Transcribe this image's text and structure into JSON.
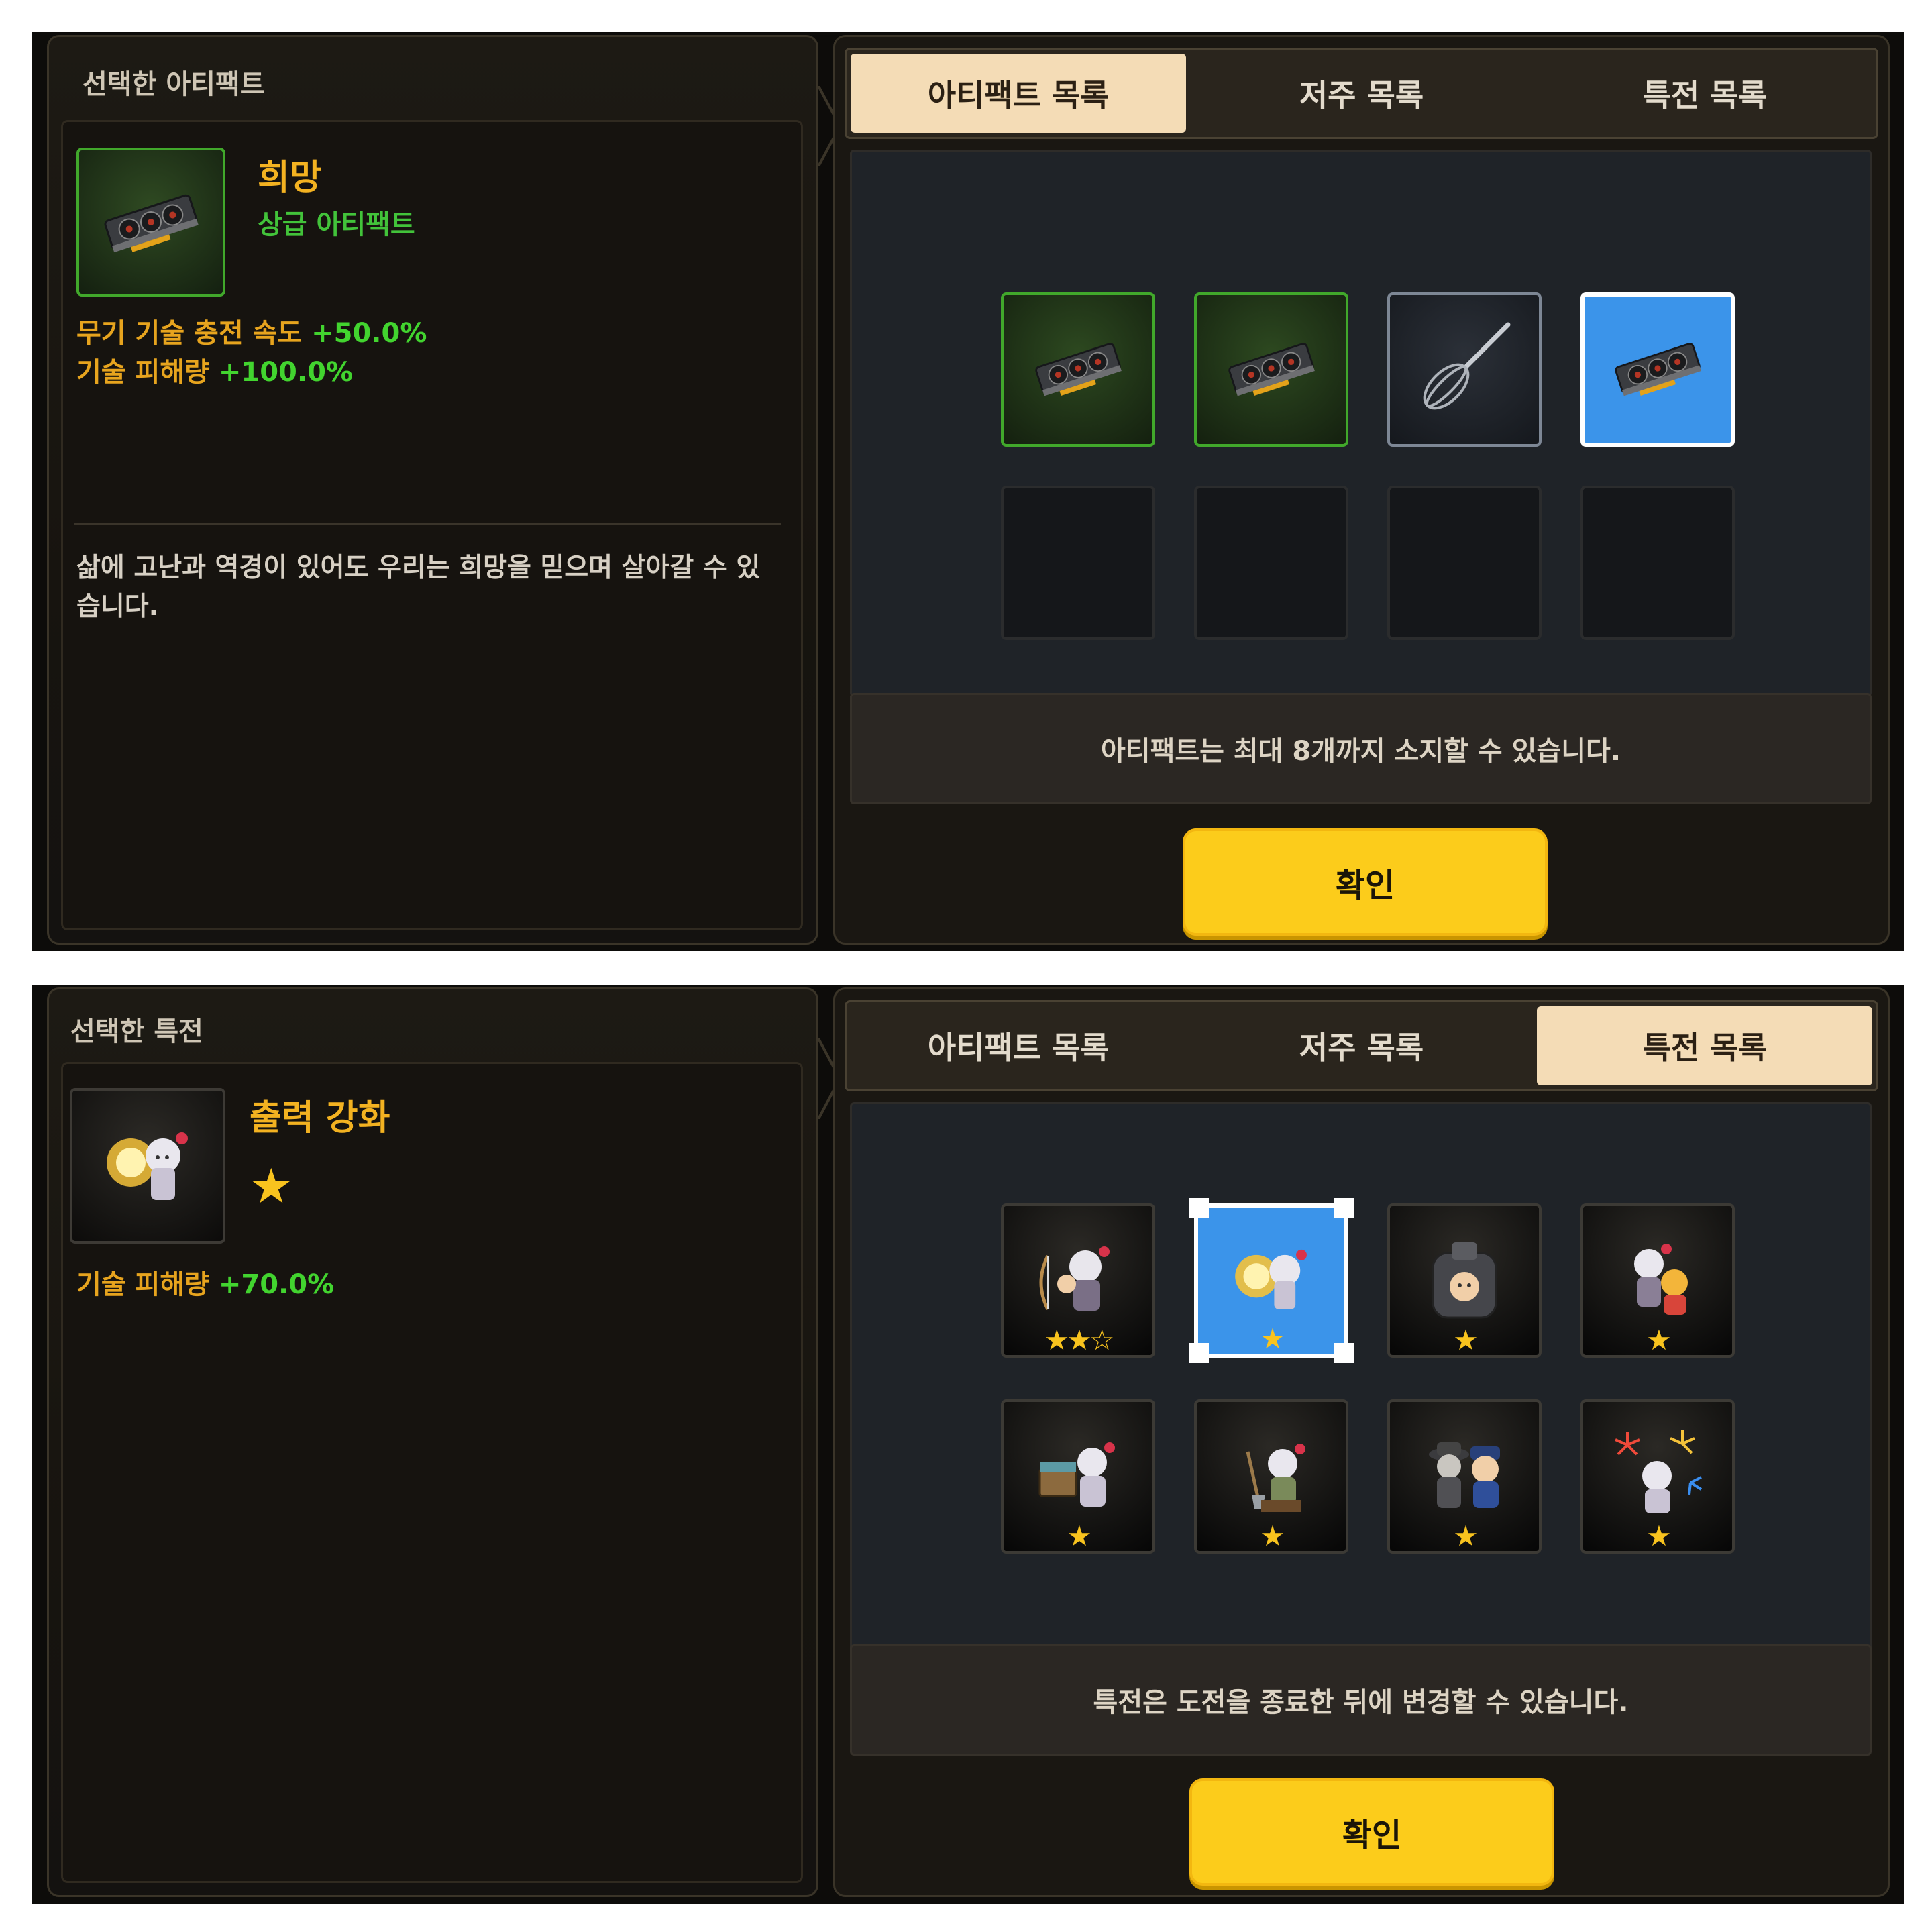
{
  "artifact_screen": {
    "detail": {
      "title": "선택한 아티팩트",
      "item_name": "희망",
      "item_grade": "상급 아티팩트",
      "icon": "graphics-card-icon",
      "stats": [
        {
          "label": "무기 기술 충전 속도 ",
          "value": "+50.0%"
        },
        {
          "label": "기술 피해량 ",
          "value": "+100.0%"
        }
      ],
      "flavor": "삶에 고난과 역경이 있어도 우리는 희망을 믿으며 살아갈 수 있습니다."
    },
    "tabs": [
      "아티팩트 목록",
      "저주 목록",
      "특전 목록"
    ],
    "active_tab": 0,
    "slots": [
      {
        "icon": "graphics-card-icon",
        "frame": "green"
      },
      {
        "icon": "graphics-card-icon",
        "frame": "green"
      },
      {
        "icon": "whisk-icon",
        "frame": "steel"
      },
      {
        "icon": "graphics-card-icon",
        "frame": "selected"
      },
      {
        "icon": "",
        "frame": "empty"
      },
      {
        "icon": "",
        "frame": "empty"
      },
      {
        "icon": "",
        "frame": "empty"
      },
      {
        "icon": "",
        "frame": "empty"
      }
    ],
    "info": "아티팩트는 최대 8개까지 소지할 수 있습니다.",
    "confirm_label": "확인"
  },
  "perk_screen": {
    "detail": {
      "title": "선택한 특전",
      "item_name": "출력 강화",
      "stars": 1,
      "icon": "chibi-hero-glow-icon",
      "stats": [
        {
          "label": "기술 피해량 ",
          "value": "+70.0%"
        }
      ]
    },
    "tabs": [
      "아티팩트 목록",
      "저주 목록",
      "특전 목록"
    ],
    "active_tab": 2,
    "slots": [
      {
        "icon": "chibi-archer-icon",
        "stars": 2,
        "max_stars": 3,
        "frame": "dark"
      },
      {
        "icon": "chibi-hero-glow-icon",
        "stars": 1,
        "frame": "selected"
      },
      {
        "icon": "chibi-armored-pod-icon",
        "stars": 1,
        "frame": "dark"
      },
      {
        "icon": "chibi-duo-icon",
        "stars": 1,
        "frame": "dark"
      },
      {
        "icon": "chibi-chest-icon",
        "stars": 1,
        "frame": "dark"
      },
      {
        "icon": "chibi-shovel-icon",
        "stars": 1,
        "frame": "dark"
      },
      {
        "icon": "chibi-detective-police-icon",
        "stars": 1,
        "frame": "dark"
      },
      {
        "icon": "chibi-fireworks-icon",
        "stars": 1,
        "frame": "dark"
      }
    ],
    "info": "특전은 도전을 종료한 뒤에 변경할 수 있습니다.",
    "confirm_label": "확인"
  },
  "colors": {
    "accent_gold": "#f3b221",
    "stat_green": "#42d42f",
    "grade_green": "#42c33a",
    "confirm_yellow": "#fccc1b",
    "selected_blue": "#3b94ea",
    "active_tab": "#f4dcb6"
  }
}
